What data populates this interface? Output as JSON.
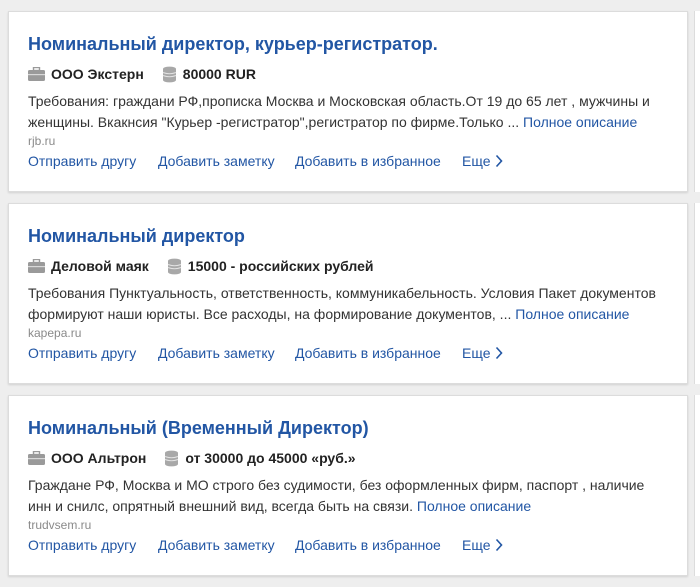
{
  "jobs": [
    {
      "title": "Номинальный директор, курьер-регистратор.",
      "company": "ООО Экстерн",
      "salary": "80000 RUR",
      "description": "Требования: граждани РФ,прописка Москва и Московская область.От 19 до 65 лет , мужчины и женщины. Вкакнсия \"Курьер -регистратор\",регистратор по фирме.Только ...",
      "full_link": "Полное описание",
      "source": "rjb.ru"
    },
    {
      "title": "Номинальный директор",
      "company": "Деловой маяк",
      "salary": "15000 - российских рублей",
      "description": "Требования Пунктуальность, ответственность, коммуникабельность. Условия Пакет документов формируют наши юристы. Все расходы, на формирование документов, ...",
      "full_link": "Полное описание",
      "source": "kapepa.ru"
    },
    {
      "title": "Номинальный (Временный Директор)",
      "company": "ООО Альтрон",
      "salary": "от 30000 до 45000 «руб.»",
      "description": "Граждане РФ, Москва и МО строго без судимости, без оформленных фирм, паспорт , наличие инн и снилс, опрятный внешний вид, всегда быть на связи.",
      "full_link": "Полное описание",
      "source": "trudvsem.ru"
    }
  ],
  "actions": {
    "send_friend": "Отправить другу",
    "add_note": "Добавить заметку",
    "add_favorite": "Добавить в избранное",
    "more": "Еще"
  },
  "icons": {
    "company": "briefcase-icon",
    "salary": "coins-icon",
    "more": "chevron-right-icon"
  },
  "colors": {
    "link": "#2256a4",
    "text": "#333333",
    "source": "#8a8a8a",
    "background": "#eeeeee",
    "card": "#ffffff"
  }
}
